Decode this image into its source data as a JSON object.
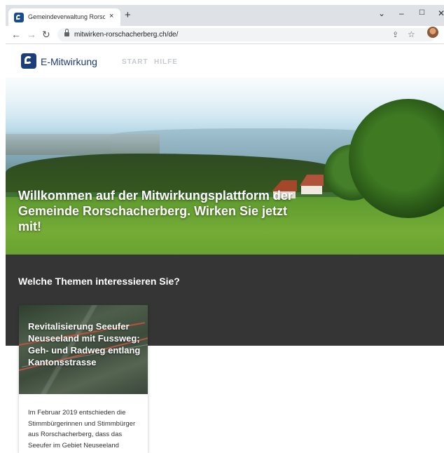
{
  "browser": {
    "tab_title": "Gemeindeverwaltung Rorschache",
    "tab_close": "×",
    "new_tab": "+",
    "window_controls": {
      "dropdown": "⌄",
      "minimize": "–",
      "maximize": "☐",
      "close": "✕"
    },
    "nav": {
      "back": "←",
      "forward": "→",
      "reload": "↻"
    },
    "url": "mitwirken-rorschacherberg.ch/de/",
    "kebab": "⋮",
    "icons": [
      "lock-icon",
      "share-icon",
      "star-icon",
      "profile-avatar",
      "menu-icon"
    ]
  },
  "site": {
    "brand": "E-Mitwirkung",
    "nav": [
      "START",
      "HILFE"
    ],
    "brand_color": "#1b3d7a"
  },
  "hero": {
    "title": "Willkommen auf der Mitwirkungsplattform der Gemeinde Rorschacherberg. Wirken Sie jetzt mit!"
  },
  "topics": {
    "heading": "Welche Themen interessieren Sie?",
    "background": "#353535",
    "cards": [
      {
        "title": "Revitalisierung Seeufer Neuseeland mit Fussweg; Geh- und Radweg entlang Kantonsstrasse",
        "description": "Im Februar 2019 entschieden die Stimmbürgerinnen und Stimmbürger aus Rorschacherberg, dass das Seeufer im Gebiet Neuseeland revitalisiert und ein"
      }
    ]
  }
}
